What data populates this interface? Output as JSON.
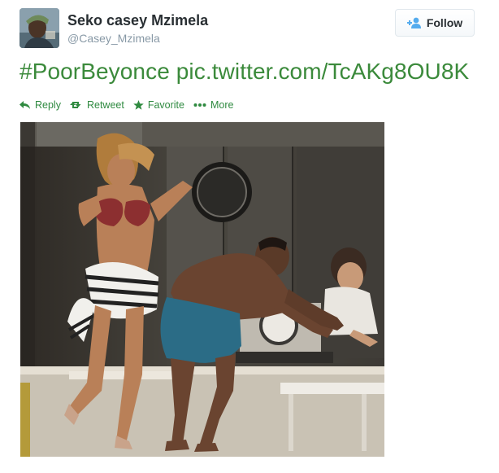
{
  "tweet": {
    "author_name": "Seko casey Mzimela",
    "author_handle": "@Casey_Mzimela",
    "text": "#PoorBeyonce pic.twitter.com/TcAKg8OU8K"
  },
  "follow_button": {
    "label": "Follow"
  },
  "actions": [
    {
      "label": "Reply",
      "icon": "reply-icon"
    },
    {
      "label": "Retweet",
      "icon": "retweet-icon"
    },
    {
      "label": "Favorite",
      "icon": "star-icon"
    },
    {
      "label": "More",
      "icon": "more-dots-icon"
    }
  ],
  "colors": {
    "link_green": "#3b8a3b",
    "action_green": "#2f8a40",
    "handle_gray": "#8899a6"
  }
}
